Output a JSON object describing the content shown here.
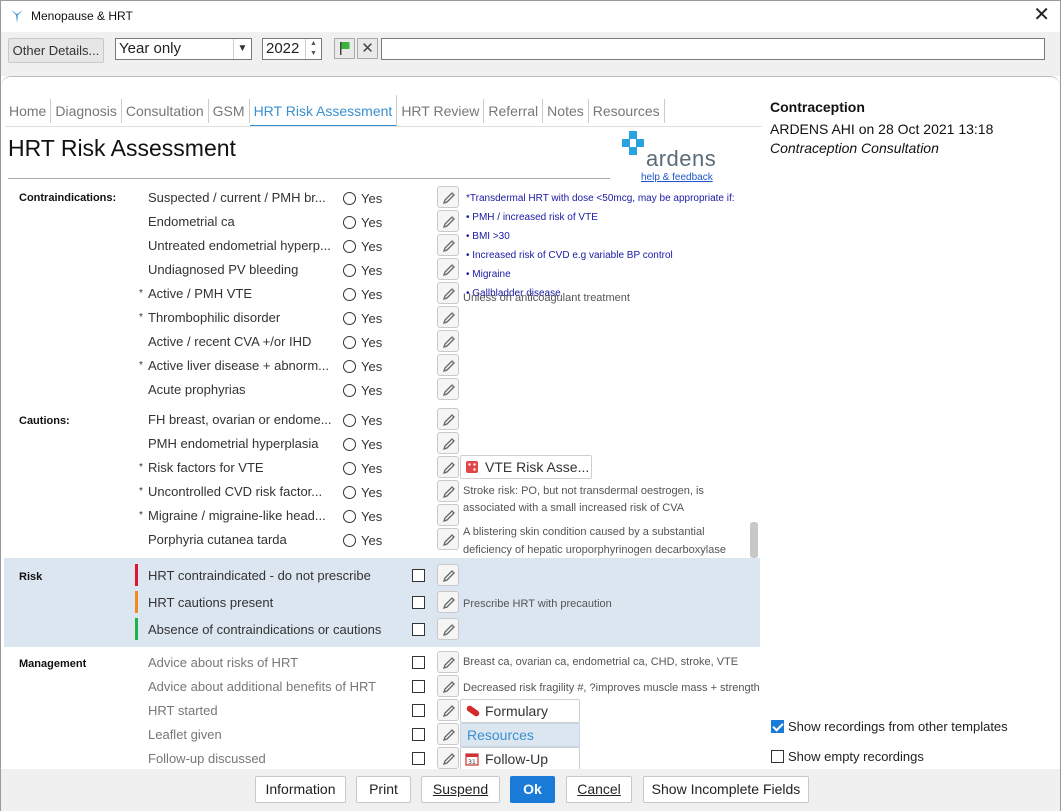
{
  "window": {
    "title": "Menopause & HRT"
  },
  "toolbar": {
    "other_details": "Other Details...",
    "period_value": "Year only",
    "year_value": "2022"
  },
  "tabs": [
    "Home",
    "Diagnosis",
    "Consultation",
    "GSM",
    "HRT Risk Assessment",
    "HRT Review",
    "Referral",
    "Notes",
    "Resources"
  ],
  "active_tab": "HRT Risk Assessment",
  "page": {
    "title": "HRT Risk Assessment",
    "logo_text": "ardens",
    "help_link": "help & feedback"
  },
  "sections": {
    "contraindications": "Contraindications:",
    "cautions": "Cautions:",
    "risk": "Risk",
    "management": "Management"
  },
  "radio_label": "Yes",
  "contraindication_rows": [
    "Suspected / current / PMH br...",
    "Endometrial ca",
    "Untreated endometrial hyperp...",
    "Undiagnosed PV bleeding",
    "Active / PMH VTE",
    "Thrombophilic disorder",
    "Active / recent CVA +/or IHD",
    "Active liver disease + abnorm...",
    "Acute prophyrias"
  ],
  "caution_rows": [
    "FH breast, ovarian or endome...",
    "PMH endometrial hyperplasia",
    "Risk factors for VTE",
    "Uncontrolled CVD risk factor...",
    "Migraine / migraine-like head...",
    "Porphyria cutanea tarda"
  ],
  "transdermal_note": {
    "line1": "*Transdermal HRT with dose <50mcg, may be appropriate if:",
    "line2": "• PMH / increased risk of VTE",
    "line3": "• BMI >30",
    "line4": "• Increased risk of CVD e.g variable BP control",
    "line5": "• Migraine",
    "line6": "• Gallbladder disease",
    "overlay": "Unless on anticoagulant treatment"
  },
  "vte_button": "VTE Risk Asse...",
  "stroke_note": {
    "line1": "Stroke risk: PO, but not transdermal oestrogen, is",
    "line2": "associated with a small increased risk of CVA"
  },
  "blister_note": {
    "line1": "A blistering skin condition caused by a substantial",
    "line2": "deficiency of hepatic uroporphyrinogen decarboxylase"
  },
  "risk_rows": [
    {
      "label": "HRT contraindicated - do not prescribe",
      "color": "#e0152d"
    },
    {
      "label": "HRT cautions present",
      "color": "#f08a24"
    },
    {
      "label": "Absence of contraindications or cautions",
      "color": "#1fb24a"
    }
  ],
  "risk_note": "Prescribe HRT with precaution",
  "management_rows": [
    "Advice about risks of HRT",
    "Advice about additional benefits of HRT",
    "HRT started",
    "Leaflet given",
    "Follow-up discussed"
  ],
  "management_notes": {
    "risks": "Breast ca, ovarian ca, endometrial ca, CHD, stroke, VTE",
    "benefits": "Decreased risk fragility #, ?improves muscle mass + strength"
  },
  "management_buttons": {
    "formulary": "Formulary",
    "resources": "Resources",
    "follow_up": "Follow-Up"
  },
  "right_panel": {
    "heading": "Contraception",
    "line1": "ARDENS AHI on 28 Oct 2021 13:18",
    "line2": "Contraception Consultation",
    "opt_show_other": "Show recordings from other templates",
    "opt_show_other_checked": true,
    "opt_show_empty": "Show empty recordings",
    "opt_show_empty_checked": false
  },
  "footer": {
    "information": "Information",
    "print": "Print",
    "suspend": "Suspend",
    "ok": "Ok",
    "cancel": "Cancel",
    "show_incomplete": "Show Incomplete Fields"
  }
}
